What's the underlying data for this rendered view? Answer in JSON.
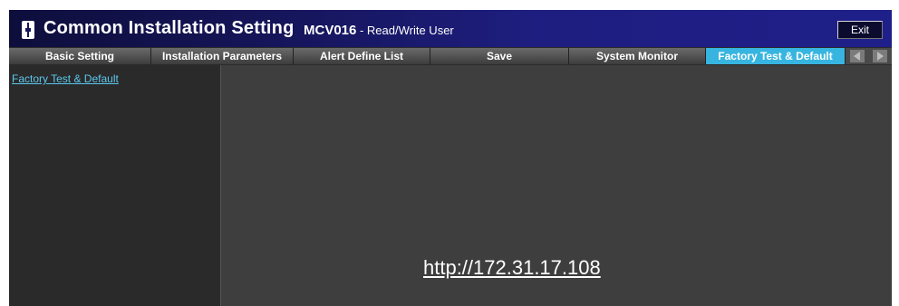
{
  "header": {
    "app_title": "Common Installation Setting",
    "device_name": "MCV016",
    "user_role": " - Read/Write User",
    "exit_label": "Exit"
  },
  "tabs": [
    {
      "label": "Basic Setting",
      "active": false
    },
    {
      "label": "Installation Parameters",
      "active": false
    },
    {
      "label": "Alert Define List",
      "active": false
    },
    {
      "label": "Save",
      "active": false
    },
    {
      "label": "System Monitor",
      "active": false
    },
    {
      "label": "Factory Test & Default",
      "active": true
    }
  ],
  "sidebar": {
    "items": [
      {
        "label": "Factory Test & Default"
      }
    ]
  },
  "content": {
    "url": "http://172.31.17.108"
  },
  "colors": {
    "accent": "#37b5e0",
    "link": "#5cc8ef",
    "titlebar": "#1e1e80"
  }
}
